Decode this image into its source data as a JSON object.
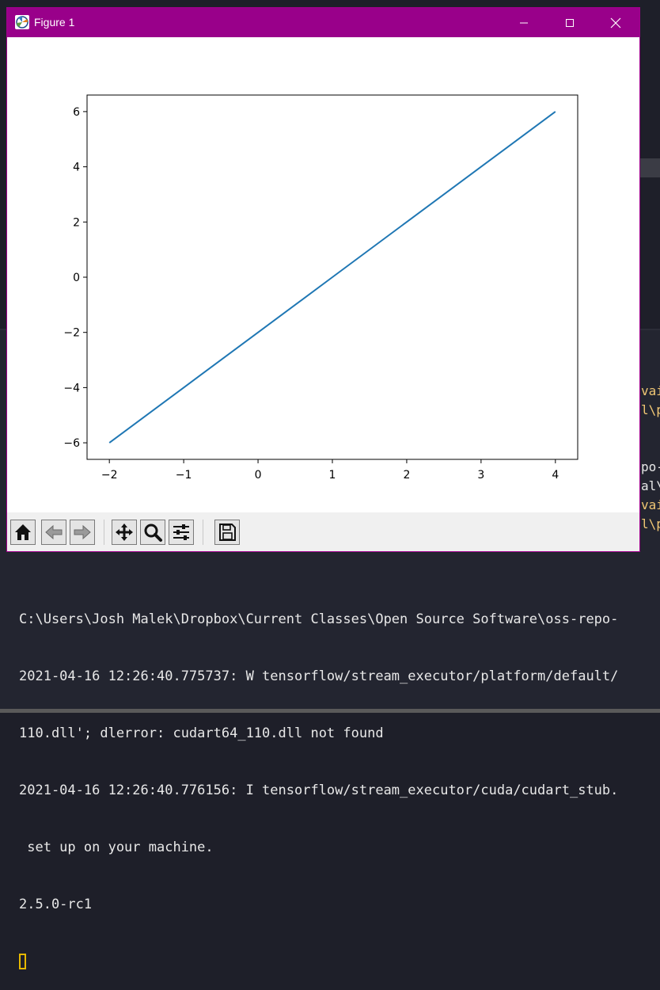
{
  "window": {
    "title": "Figure 1"
  },
  "toolbar": {
    "buttons": [
      "home-icon",
      "back-icon",
      "forward-icon",
      "pan-icon",
      "zoom-icon",
      "configure-subplots-icon",
      "save-icon"
    ]
  },
  "chart_data": {
    "type": "line",
    "x": [
      -2,
      -1,
      0,
      1,
      2,
      3,
      4
    ],
    "series": [
      {
        "values": [
          -6,
          -4,
          -2,
          0,
          2,
          4,
          6
        ],
        "color": "#1f77b4"
      }
    ],
    "xticks": [
      "−2",
      "−1",
      "0",
      "1",
      "2",
      "3",
      "4"
    ],
    "yticks": [
      "−6",
      "−4",
      "−2",
      "0",
      "2",
      "4",
      "6"
    ],
    "xlim": [
      -2.3,
      4.3
    ],
    "ylim": [
      -6.6,
      6.6
    ],
    "grid": false,
    "title": "",
    "xlabel": "",
    "ylabel": ""
  },
  "terminal": {
    "lines": [
      "C:\\Users\\Josh Malek\\Dropbox\\Current Classes\\Open Source Software\\oss-repo-",
      "2021-04-16 12:26:40.775737: W tensorflow/stream_executor/platform/default/",
      "110.dll'; dlerror: cudart64_110.dll not found",
      "2021-04-16 12:26:40.776156: I tensorflow/stream_executor/cuda/cudart_stub.",
      " set up on your machine.",
      "2.5.0-rc1"
    ]
  },
  "side_fragments": [
    {
      "text": "vai",
      "color": "#f0c674"
    },
    {
      "text": "l\\p",
      "color": "#f0c674"
    },
    {
      "text": "po-",
      "color": "#e8e8e8"
    },
    {
      "text": "al\\",
      "color": "#e8e8e8"
    },
    {
      "text": "vai",
      "color": "#f0c674"
    },
    {
      "text": "l\\p",
      "color": "#f0c674"
    }
  ]
}
